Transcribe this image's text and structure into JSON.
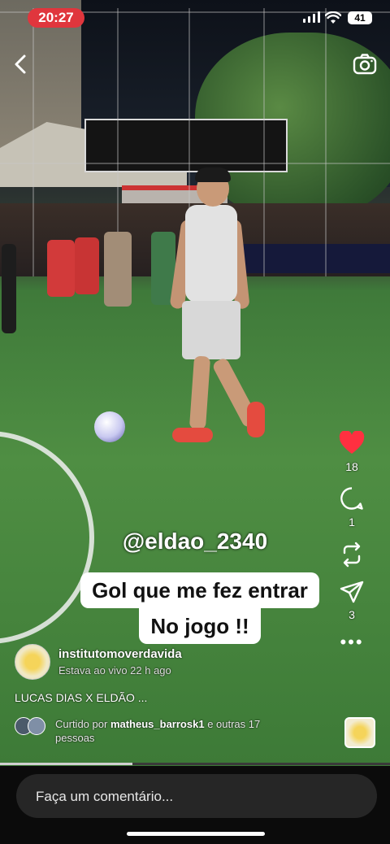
{
  "status_bar": {
    "time": "20:27",
    "battery": "41"
  },
  "video": {
    "handle_overlay": "@eldao_2340",
    "caption_lines": [
      "Gol que me fez entrar",
      "No jogo !!"
    ],
    "progress": 0.34
  },
  "actions": {
    "likes": "18",
    "comments": "1",
    "shares": "3"
  },
  "author": {
    "name": "institutomoverdavida",
    "subtitle": "Estava ao vivo 22 h ago"
  },
  "description": "LUCAS DIAS X ELDÃO ...",
  "liked_by": {
    "prefix": "Curtido por",
    "user": "matheus_barrosk1",
    "suffix": "e outras 17 pessoas"
  },
  "comment": {
    "placeholder": "Faça um comentário..."
  },
  "colors": {
    "status_pill": "#e0363d",
    "like_heart": "#ff3040"
  }
}
